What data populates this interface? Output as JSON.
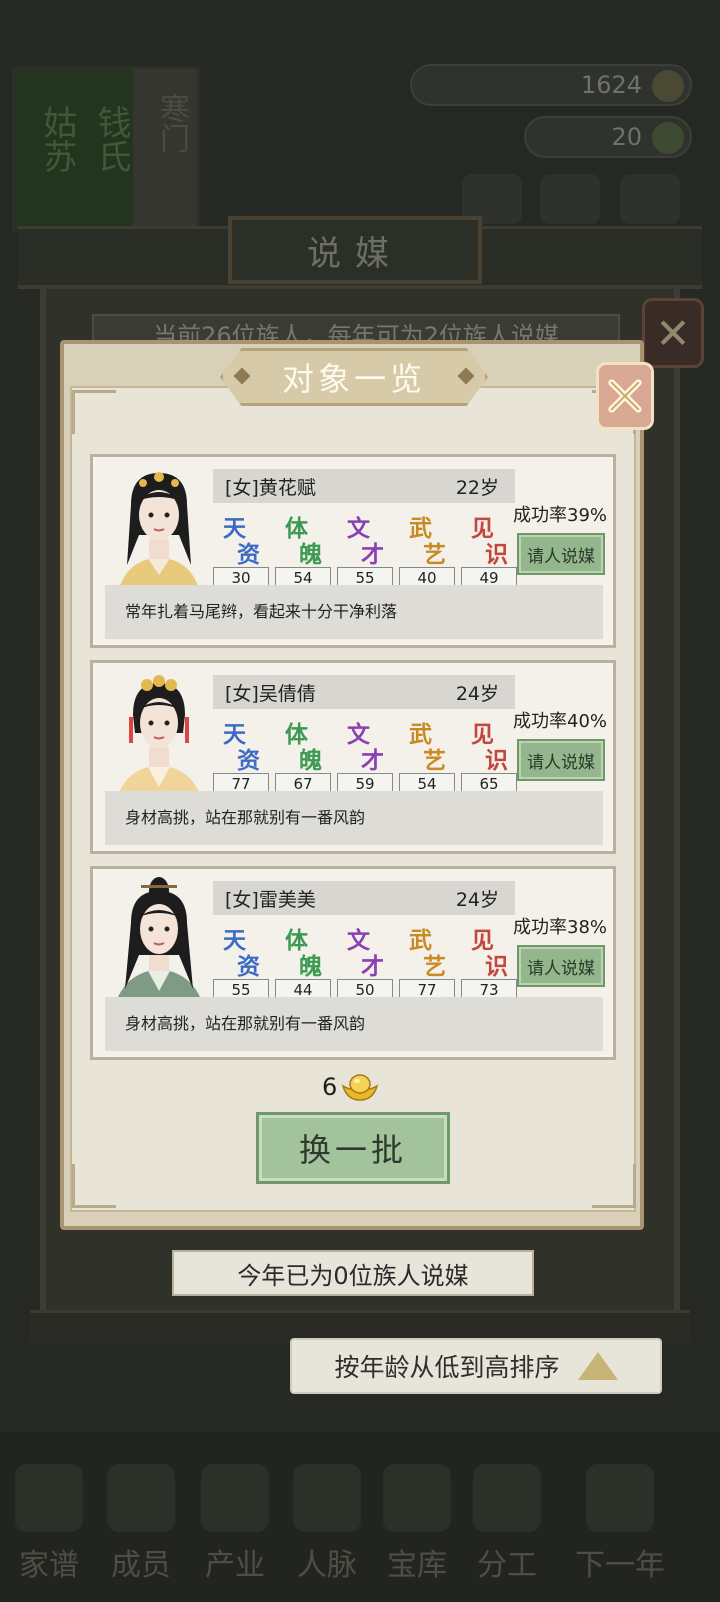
{
  "resources": {
    "gems": "1​624",
    "gold": "20"
  },
  "family_plaque": {
    "place": "姑苏",
    "surname": "钱氏",
    "rank": "寒门"
  },
  "matchmaking": {
    "title": "说媒",
    "subtitle": "当前26位族人，每年可为2位族人说媒"
  },
  "modal": {
    "title": "对象一览",
    "stat_labels": [
      {
        "c1": "天",
        "c2": "资",
        "color": "#3d6bc4"
      },
      {
        "c1": "体",
        "c2": "魄",
        "color": "#3c9a52"
      },
      {
        "c1": "文",
        "c2": "才",
        "color": "#8b3fb5"
      },
      {
        "c1": "武",
        "c2": "艺",
        "color": "#c98a24"
      },
      {
        "c1": "见",
        "c2": "识",
        "color": "#c2473d"
      }
    ],
    "candidates": [
      {
        "name": "[女]黄花赋",
        "age": "22岁",
        "stats": [
          "30",
          "54",
          "55",
          "40",
          "49"
        ],
        "success_rate": "成功率39%",
        "action": "请人说媒",
        "description": "常年扎着马尾辫，看起来十分干净利落"
      },
      {
        "name": "[女]吴倩倩",
        "age": "24岁",
        "stats": [
          "77",
          "67",
          "59",
          "54",
          "65"
        ],
        "success_rate": "成功率40%",
        "action": "请人说媒",
        "description": "身材高挑，站在那就别有一番风韵"
      },
      {
        "name": "[女]雷美美",
        "age": "24岁",
        "stats": [
          "55",
          "44",
          "50",
          "77",
          "73"
        ],
        "success_rate": "成功率38%",
        "action": "请人说媒",
        "description": "身材高挑，站在那就别有一番风韵"
      }
    ],
    "refresh_cost": "6",
    "refresh_label": "换一批"
  },
  "footer_status": "今年已为0位族人说媒",
  "sort_label": "按年龄从低到高排序",
  "bottom_nav": [
    "家谱",
    "成员",
    "产业",
    "人脉",
    "宝库",
    "分工",
    "下一年"
  ],
  "colors": {
    "button_green": "#93b68c",
    "panel_cream": "#e8e4d7",
    "close_pink": "#d9a892"
  }
}
